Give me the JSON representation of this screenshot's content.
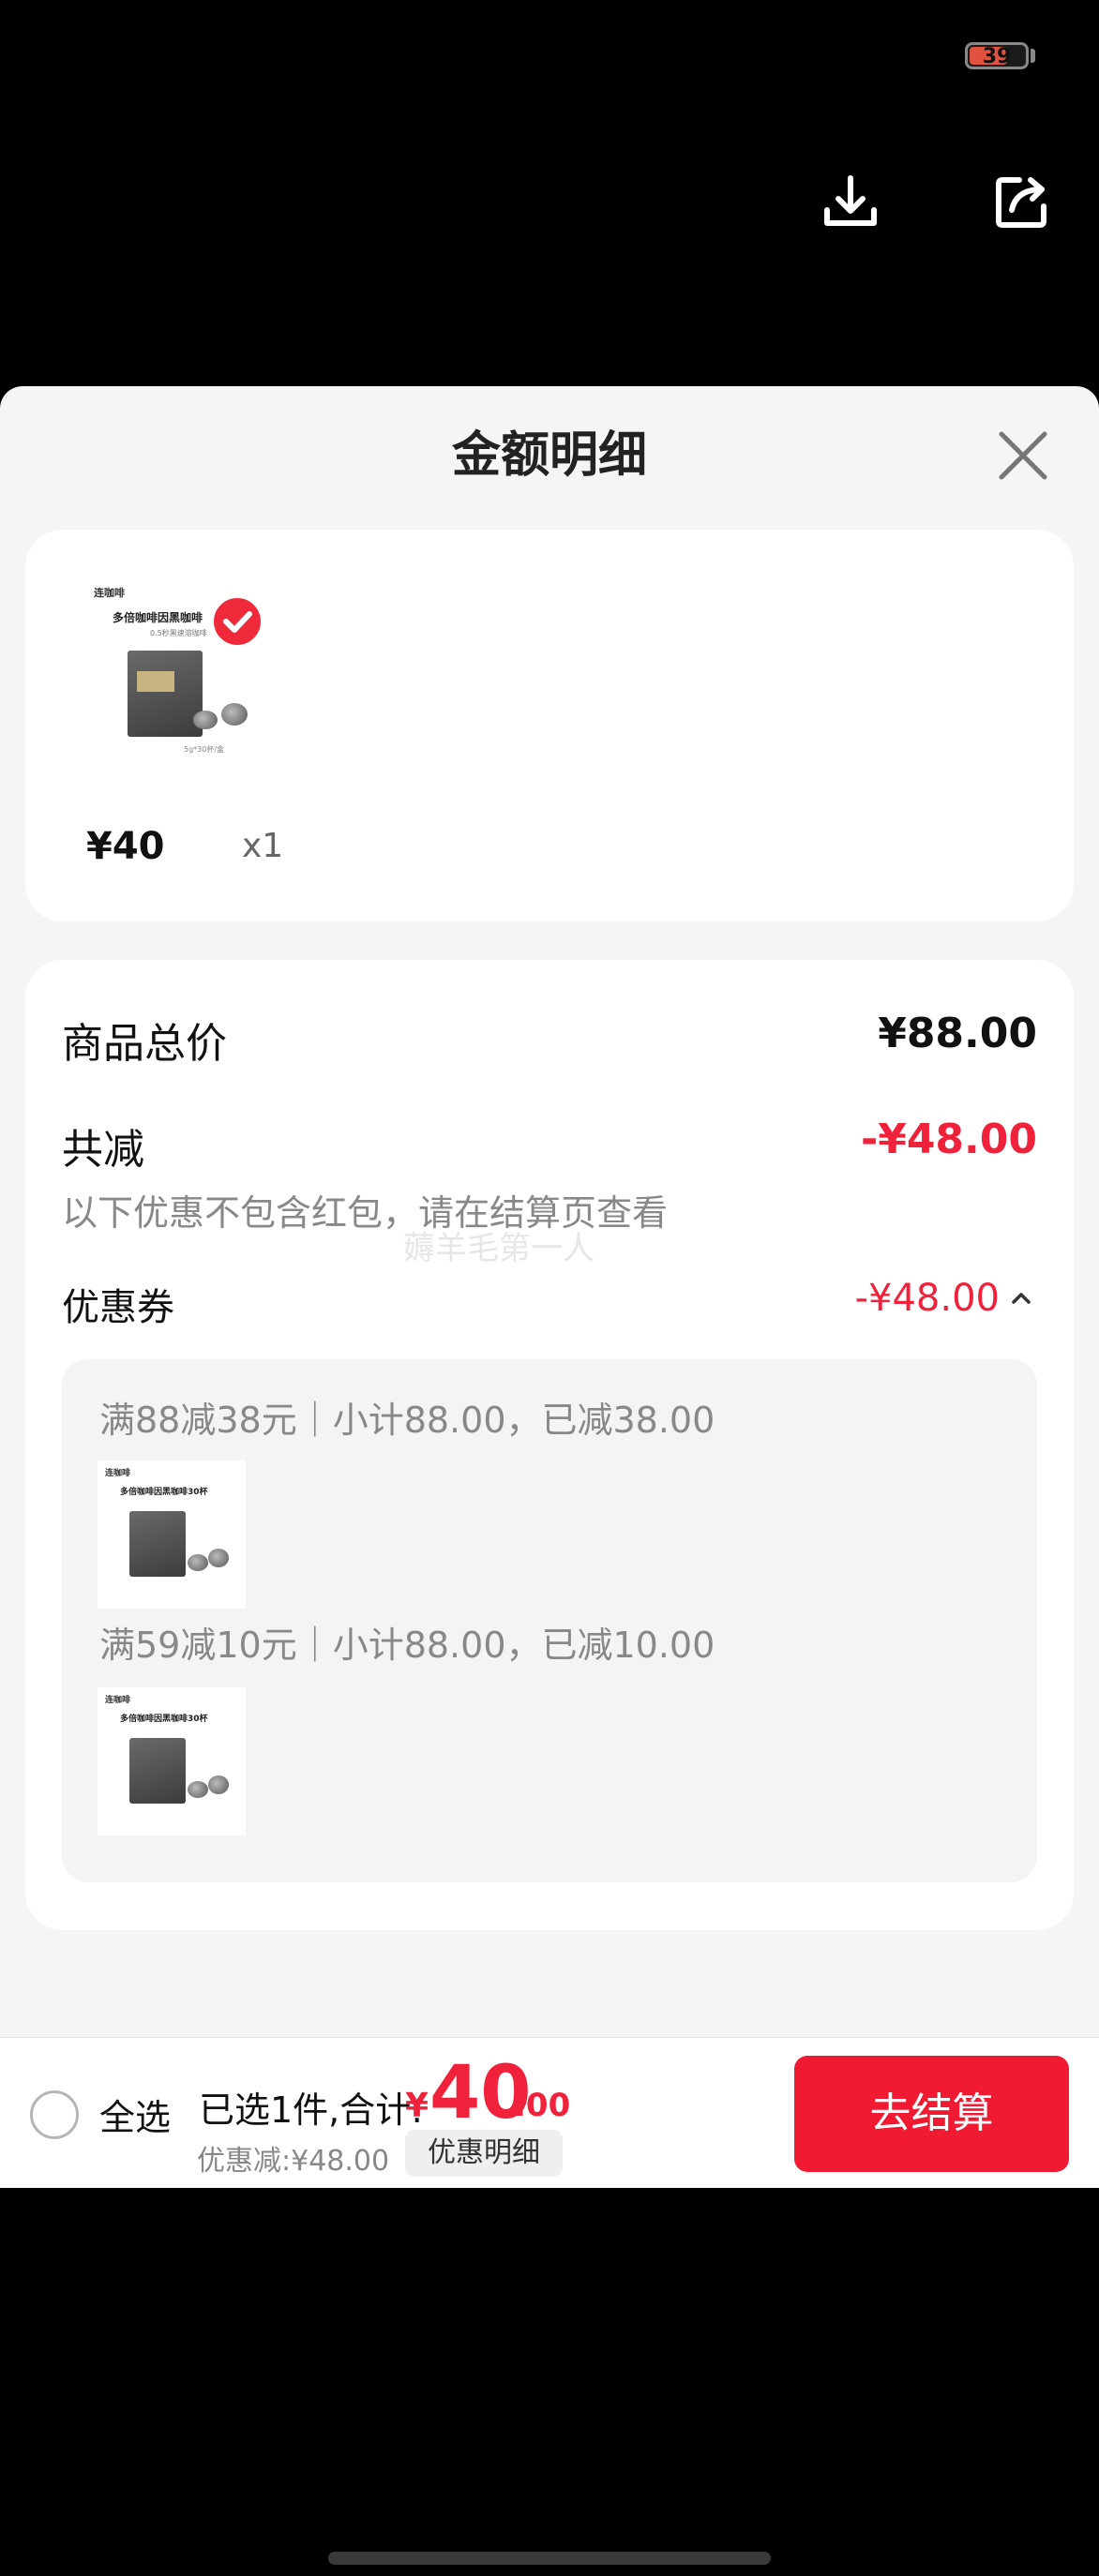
{
  "status_bar": {
    "battery": "39"
  },
  "top_actions": {
    "download_icon": "download-icon",
    "share_icon": "share-icon"
  },
  "sheet": {
    "title": "金额明细",
    "close_icon": "close-icon"
  },
  "product": {
    "price": "¥40",
    "quantity": "x1",
    "brand": "连咖啡",
    "package_title": "多倍咖啡因黑咖啡",
    "package_sub": "0.5秒黑速溶咖啡",
    "package_foot": "5g*30杯/盒",
    "selected": true
  },
  "summary": {
    "total_label": "商品总价",
    "total_value": "¥88.00",
    "reduce_label": "共减",
    "reduce_value": "-¥48.00",
    "note": "以下优惠不包含红包，请在结算页查看",
    "watermark": "薅羊毛第一人",
    "coupon_label": "优惠券",
    "coupon_value": "-¥48.00",
    "coupons": [
      {
        "text": "满88减38元｜小计88.00，已减38.00"
      },
      {
        "text": "满59减10元｜小计88.00，已减10.00"
      }
    ],
    "coupon_package_title": "多倍咖啡因黑咖啡30杯"
  },
  "bottom_bar": {
    "select_all": "全选",
    "selected_text": "已选1件,合计:",
    "total_symbol": "¥",
    "total_int": "40",
    "total_dec": ".00",
    "discount_text": "优惠减:¥48.00",
    "discount_detail": "优惠明细",
    "checkout": "去结算"
  },
  "colors": {
    "accent": "#f0213a",
    "button": "#f01b33",
    "background": "#f5f5f5"
  }
}
